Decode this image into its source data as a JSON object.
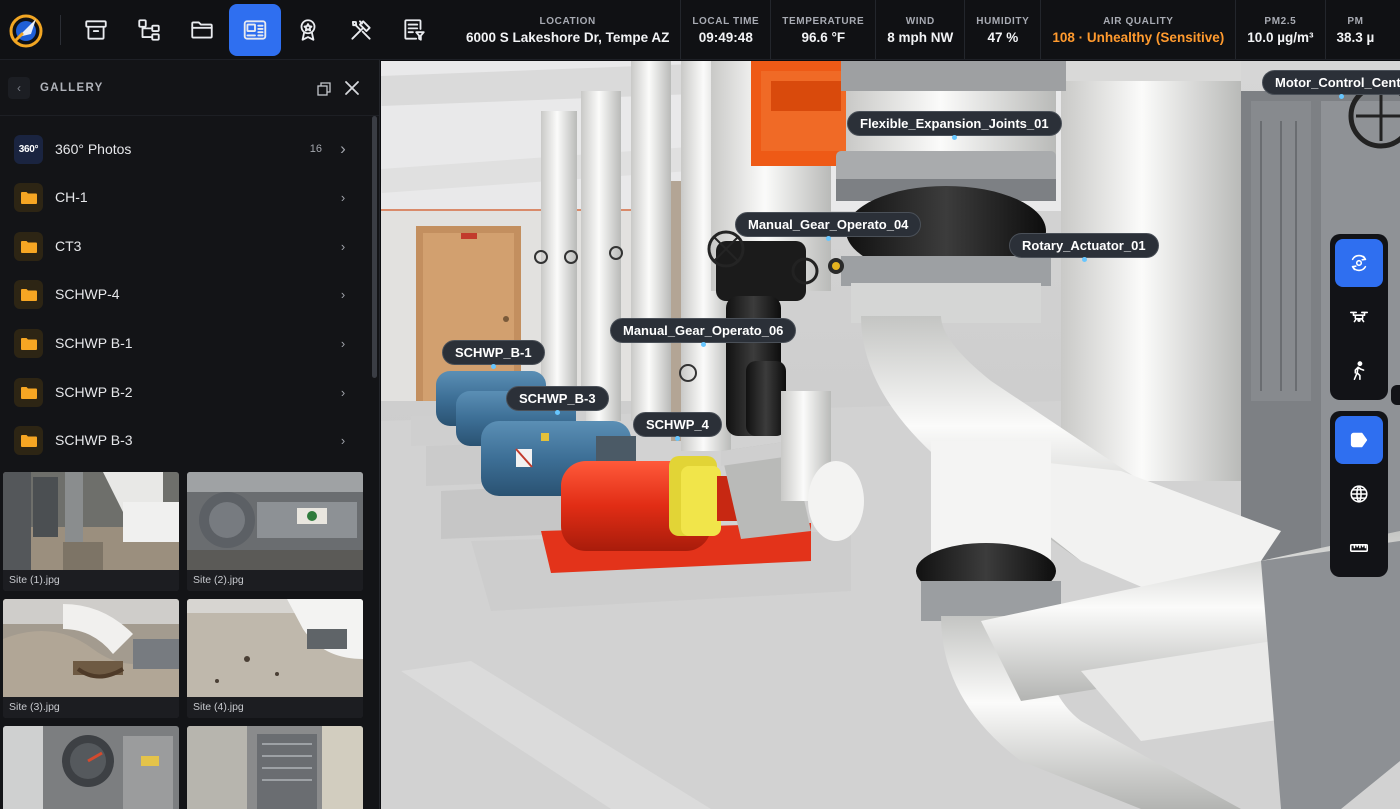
{
  "topbar": {
    "tools": [
      {
        "name": "archive-tool",
        "icon": "archive-icon",
        "active": false
      },
      {
        "name": "hierarchy-tool",
        "icon": "hierarchy-icon",
        "active": false
      },
      {
        "name": "folder-tool",
        "icon": "folder-icon",
        "active": false
      },
      {
        "name": "gallery-tool",
        "icon": "gallery-icon",
        "active": true
      },
      {
        "name": "badge-tool",
        "icon": "award-icon",
        "active": false
      },
      {
        "name": "tools-tool",
        "icon": "hammer-wrench-icon",
        "active": false
      },
      {
        "name": "report-tool",
        "icon": "report-filter-icon",
        "active": false
      }
    ],
    "stats": [
      {
        "label": "LOCATION",
        "value": "6000 S Lakeshore Dr, Tempe AZ"
      },
      {
        "label": "LOCAL TIME",
        "value": "09:49:48"
      },
      {
        "label": "TEMPERATURE",
        "value": "96.6 °F"
      },
      {
        "label": "WIND",
        "value": "8 mph NW"
      },
      {
        "label": "HUMIDITY",
        "value": "47 %"
      },
      {
        "label": "AIR QUALITY",
        "value": "108 · Unhealthy (Sensitive)",
        "status_color": "#ff9a2e"
      },
      {
        "label": "PM2.5",
        "value": "10.0 µg/m³"
      },
      {
        "label": "PM",
        "value": "38.3 µ"
      }
    ]
  },
  "gallery": {
    "title": "GALLERY",
    "folders": [
      {
        "name": "360° Photos",
        "icon": "360-icon",
        "icon_text": "360°",
        "count": "16"
      },
      {
        "name": "CH-1",
        "icon": "folder-icon",
        "count": ""
      },
      {
        "name": "CT3",
        "icon": "folder-icon",
        "count": ""
      },
      {
        "name": "SCHWP-4",
        "icon": "folder-icon",
        "count": ""
      },
      {
        "name": "SCHWP B-1",
        "icon": "folder-icon",
        "count": ""
      },
      {
        "name": "SCHWP B-2",
        "icon": "folder-icon",
        "count": ""
      },
      {
        "name": "SCHWP B-3",
        "icon": "folder-icon",
        "count": ""
      }
    ],
    "photos": [
      {
        "caption": "Site (1).jpg"
      },
      {
        "caption": "Site (2).jpg"
      },
      {
        "caption": "Site (3).jpg"
      },
      {
        "caption": "Site (4).jpg"
      },
      {
        "caption": ""
      },
      {
        "caption": ""
      }
    ]
  },
  "viewport": {
    "tags": [
      {
        "label": "Motor_Control_Cente"
      },
      {
        "label": "Flexible_Expansion_Joints_01"
      },
      {
        "label": "Manual_Gear_Operato_04"
      },
      {
        "label": "Rotary_Actuator_01"
      },
      {
        "label": "Manual_Gear_Operato_06"
      },
      {
        "label": "SCHWP_B-1"
      },
      {
        "label": "SCHWP_B-3"
      },
      {
        "label": "SCHWP_4"
      }
    ]
  },
  "right_toolbar": {
    "groups": [
      [
        {
          "name": "orbit-view-button",
          "icon": "orbit-icon",
          "active": true
        },
        {
          "name": "drone-view-button",
          "icon": "drone-icon",
          "active": false
        },
        {
          "name": "walk-view-button",
          "icon": "walking-person-icon",
          "active": false
        }
      ],
      [
        {
          "name": "tags-button",
          "icon": "tag-icon",
          "active": true
        },
        {
          "name": "globe-button",
          "icon": "globe-icon",
          "active": false
        },
        {
          "name": "measure-button",
          "icon": "ruler-icon",
          "active": false
        }
      ]
    ]
  },
  "colors": {
    "accent": "#2f6ff0",
    "warning": "#ff9a2e",
    "folder": "#f6a623",
    "tag_dot": "#67c6ff"
  }
}
